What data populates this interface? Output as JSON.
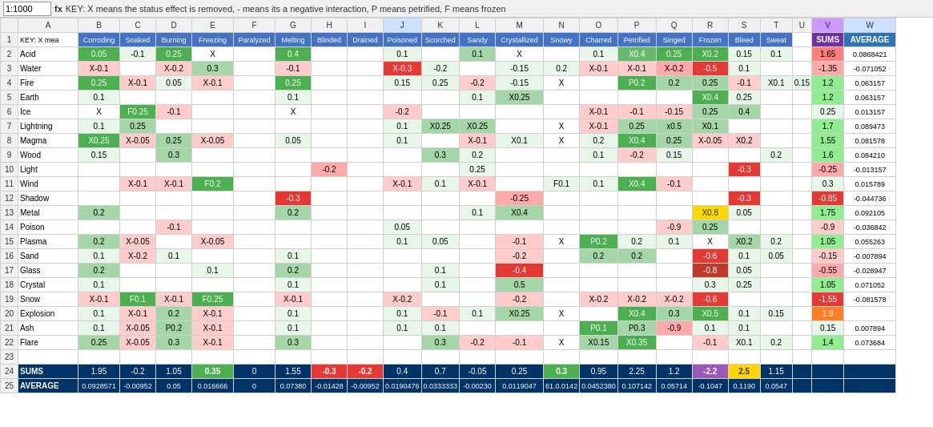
{
  "toolbar": {
    "zoom": "1:1000",
    "fx_label": "fx",
    "formula": "KEY: X means the status effect is removed, - means its a negative interaction, P means petrified, F means frozen"
  },
  "col_headers": [
    "",
    "A",
    "B",
    "C",
    "D",
    "E",
    "F",
    "G",
    "H",
    "I",
    "J",
    "K",
    "L",
    "M",
    "N",
    "O",
    "P",
    "Q",
    "R",
    "S",
    "T",
    "U",
    "V",
    "W"
  ],
  "col_labels": {
    "B": "Corroding",
    "C": "Soaked",
    "D": "Burning",
    "E": "Freezing",
    "F": "Paralyzed",
    "G": "Melting",
    "H": "Blinded",
    "I": "Drained",
    "J": "Poisoned",
    "K": "Scorched",
    "L": "Sandy",
    "M": "Crystallized",
    "N": "Snowy",
    "O": "Charred",
    "P": "Petrified",
    "Q": "Singed",
    "R": "Frozen",
    "S": "Bleed",
    "T": "Sweat",
    "U": "",
    "V": "SUMS",
    "W": "AVERAGE"
  },
  "rows": [
    {
      "num": 1,
      "label": "KEY: X mea",
      "cells": {
        "B": "Corroding",
        "C": "Soaked",
        "D": "Burning",
        "E": "Freezing",
        "F": "Paralyzed",
        "G": "Melting",
        "H": "Blinded",
        "I": "Drained",
        "J": "Poisoned",
        "K": "Scorched",
        "L": "Sandy",
        "M": "Crystallized",
        "N": "Snowy",
        "O": "Charred",
        "P": "Petrified",
        "Q": "Singed",
        "R": "Frozen",
        "S": "Bleed",
        "T": "Sweat",
        "U": "",
        "V": "SUMS",
        "W": "AVERAGE"
      }
    },
    {
      "num": 2,
      "label": "Acid"
    },
    {
      "num": 3,
      "label": "Water"
    },
    {
      "num": 4,
      "label": "Fire"
    },
    {
      "num": 5,
      "label": "Earth"
    },
    {
      "num": 6,
      "label": "Ice"
    },
    {
      "num": 7,
      "label": "Lightning"
    },
    {
      "num": 8,
      "label": "Magma"
    },
    {
      "num": 9,
      "label": "Wood"
    },
    {
      "num": 10,
      "label": "Light"
    },
    {
      "num": 11,
      "label": "Wind"
    },
    {
      "num": 12,
      "label": "Shadow"
    },
    {
      "num": 13,
      "label": "Metal"
    },
    {
      "num": 14,
      "label": "Poison"
    },
    {
      "num": 15,
      "label": "Plasma"
    },
    {
      "num": 16,
      "label": "Sand"
    },
    {
      "num": 17,
      "label": "Glass"
    },
    {
      "num": 18,
      "label": "Crystal"
    },
    {
      "num": 19,
      "label": "Snow"
    },
    {
      "num": 20,
      "label": "Explosion"
    },
    {
      "num": 21,
      "label": "Ash"
    },
    {
      "num": 22,
      "label": "Flare"
    },
    {
      "num": 23,
      "label": ""
    },
    {
      "num": 24,
      "label": "SUMS"
    },
    {
      "num": 25,
      "label": "AVERAGE"
    }
  ]
}
